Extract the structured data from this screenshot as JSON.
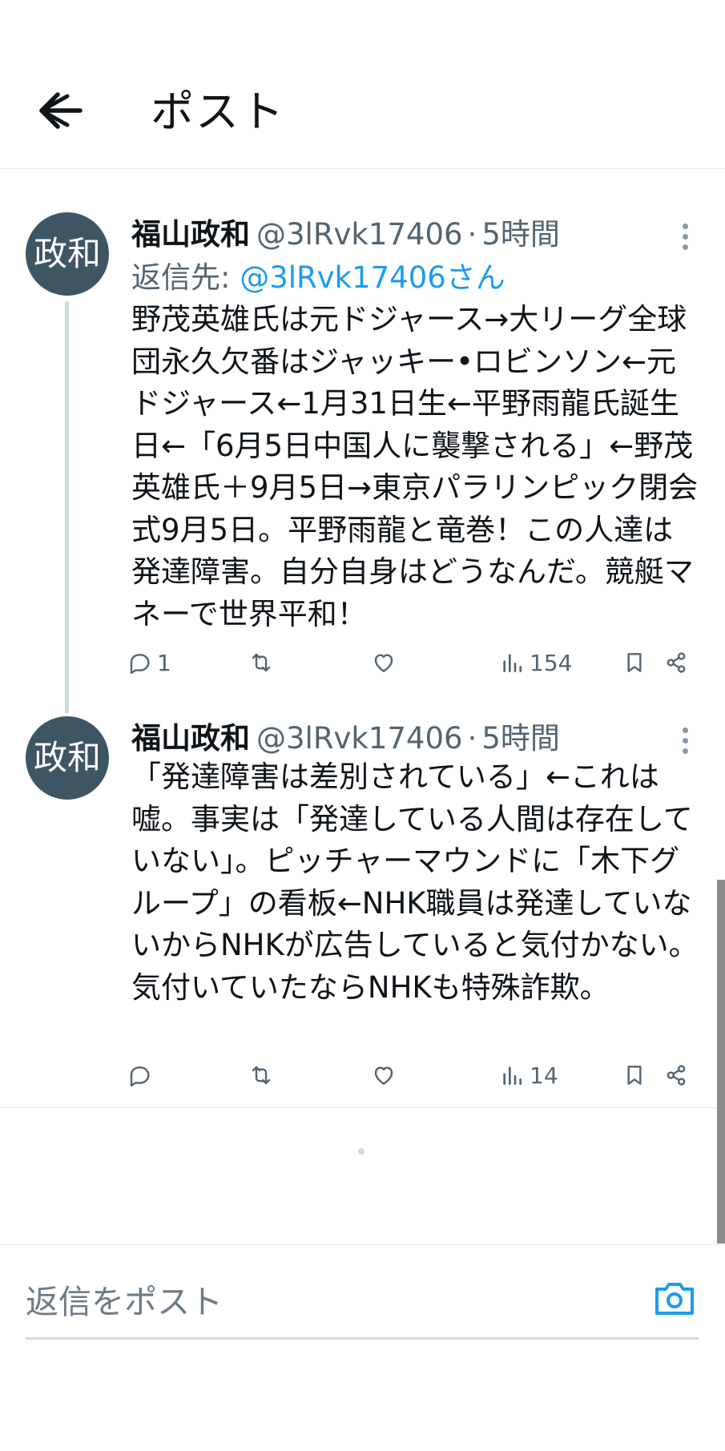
{
  "header": {
    "title": "ポスト",
    "back_icon": "back-arrow-icon"
  },
  "posts": [
    {
      "avatar_text": "政和",
      "name": "福山政和",
      "handle": "@3lRvk17406",
      "separator": "·",
      "time": "5時間",
      "reply_prefix": "返信先: ",
      "reply_mention": "@3lRvk17406さん",
      "text": "野茂英雄氏は元ドジャース→大リーグ全球団永久欠番はジャッキー•ロビンソン←元ドジャース←1月31日生←平野雨龍氏誕生日←「6月5日中国人に襲撃される」←野茂英雄氏＋9月5日→東京パラリンピック閉会式9月5日。平野雨龍と竜巻！この人達は発達障害。自分自身はどうなんだ。競艇マネーで世界平和！",
      "replies": "1",
      "views": "154"
    },
    {
      "avatar_text": "政和",
      "name": "福山政和",
      "handle": "@3lRvk17406",
      "separator": "·",
      "time": "5時間",
      "text": "「発達障害は差別されている」←これは嘘。事実は「発達している人間は存在していない」。ピッチャーマウンドに「木下グループ」の看板←NHK職員は発達していないからNHKが広告していると気付かない。気付いていたならNHKも特殊詐欺。",
      "replies": "",
      "views": "14"
    }
  ],
  "compose": {
    "placeholder": "返信をポスト",
    "camera_icon": "camera-icon"
  },
  "colors": {
    "accent": "#1d9bf0",
    "text": "#0f1419",
    "muted": "#536471",
    "avatar_bg": "#3e5563"
  }
}
